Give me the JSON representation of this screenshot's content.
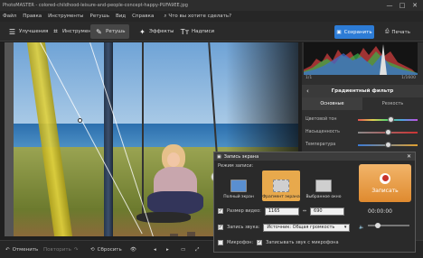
{
  "window": {
    "title": "PhotoMASTER - colored-childhood-leisure-and-people-concept-happy-PUFA9EE.jpg",
    "controls": [
      "—",
      "□",
      "✕"
    ]
  },
  "menu": {
    "items": [
      "Файл",
      "Правка",
      "Инструменты",
      "Ретушь",
      "Вид",
      "Справка"
    ],
    "search_placeholder": "Что вы хотите сделать?"
  },
  "toolbar": {
    "tools": [
      {
        "label": "Улучшения",
        "icon": "sliders-icon"
      },
      {
        "label": "Инструменты",
        "icon": "crop-icon"
      },
      {
        "label": "Ретушь",
        "icon": "brush-icon",
        "active": true
      },
      {
        "label": "Эффекты",
        "icon": "magic-wand-icon"
      },
      {
        "label": "Надписи",
        "icon": "text-icon"
      }
    ],
    "save_label": "Сохранить",
    "print_label": "Печать"
  },
  "image_info": {
    "left": "1/1",
    "right": "1/1600"
  },
  "panel": {
    "header": "Градиентный фильтр",
    "tabs": [
      "Основные",
      "Резкость"
    ],
    "sliders": [
      {
        "label": "Цветовой тон",
        "value": 0.55
      },
      {
        "label": "Насыщенность",
        "value": 0.5
      },
      {
        "label": "Температура",
        "value": 0.5
      }
    ]
  },
  "bottom": {
    "undo_label": "Отменить",
    "redo_label": "Повторить",
    "reset_label": "Сбросить"
  },
  "dialog": {
    "title": "Запись экрана",
    "subtitle": "Режим записи:",
    "modes": [
      {
        "label": "Полный экран",
        "active": false
      },
      {
        "label": "Фрагмент экрана",
        "active": true
      },
      {
        "label": "Выбранное окно",
        "active": false
      }
    ],
    "record_label": "Записать",
    "time": "00:00:00",
    "size_label": "Размер видео:",
    "width": "1165",
    "height": "690",
    "sound_label": "Запись звука:",
    "sound_source": "Источник: Общая громкость",
    "mic_label": "Микрофон:",
    "mic_option": "Записывать звук с микрофона"
  },
  "colors": {
    "accent": "#2d7cd6",
    "record": "#e8a94c"
  }
}
